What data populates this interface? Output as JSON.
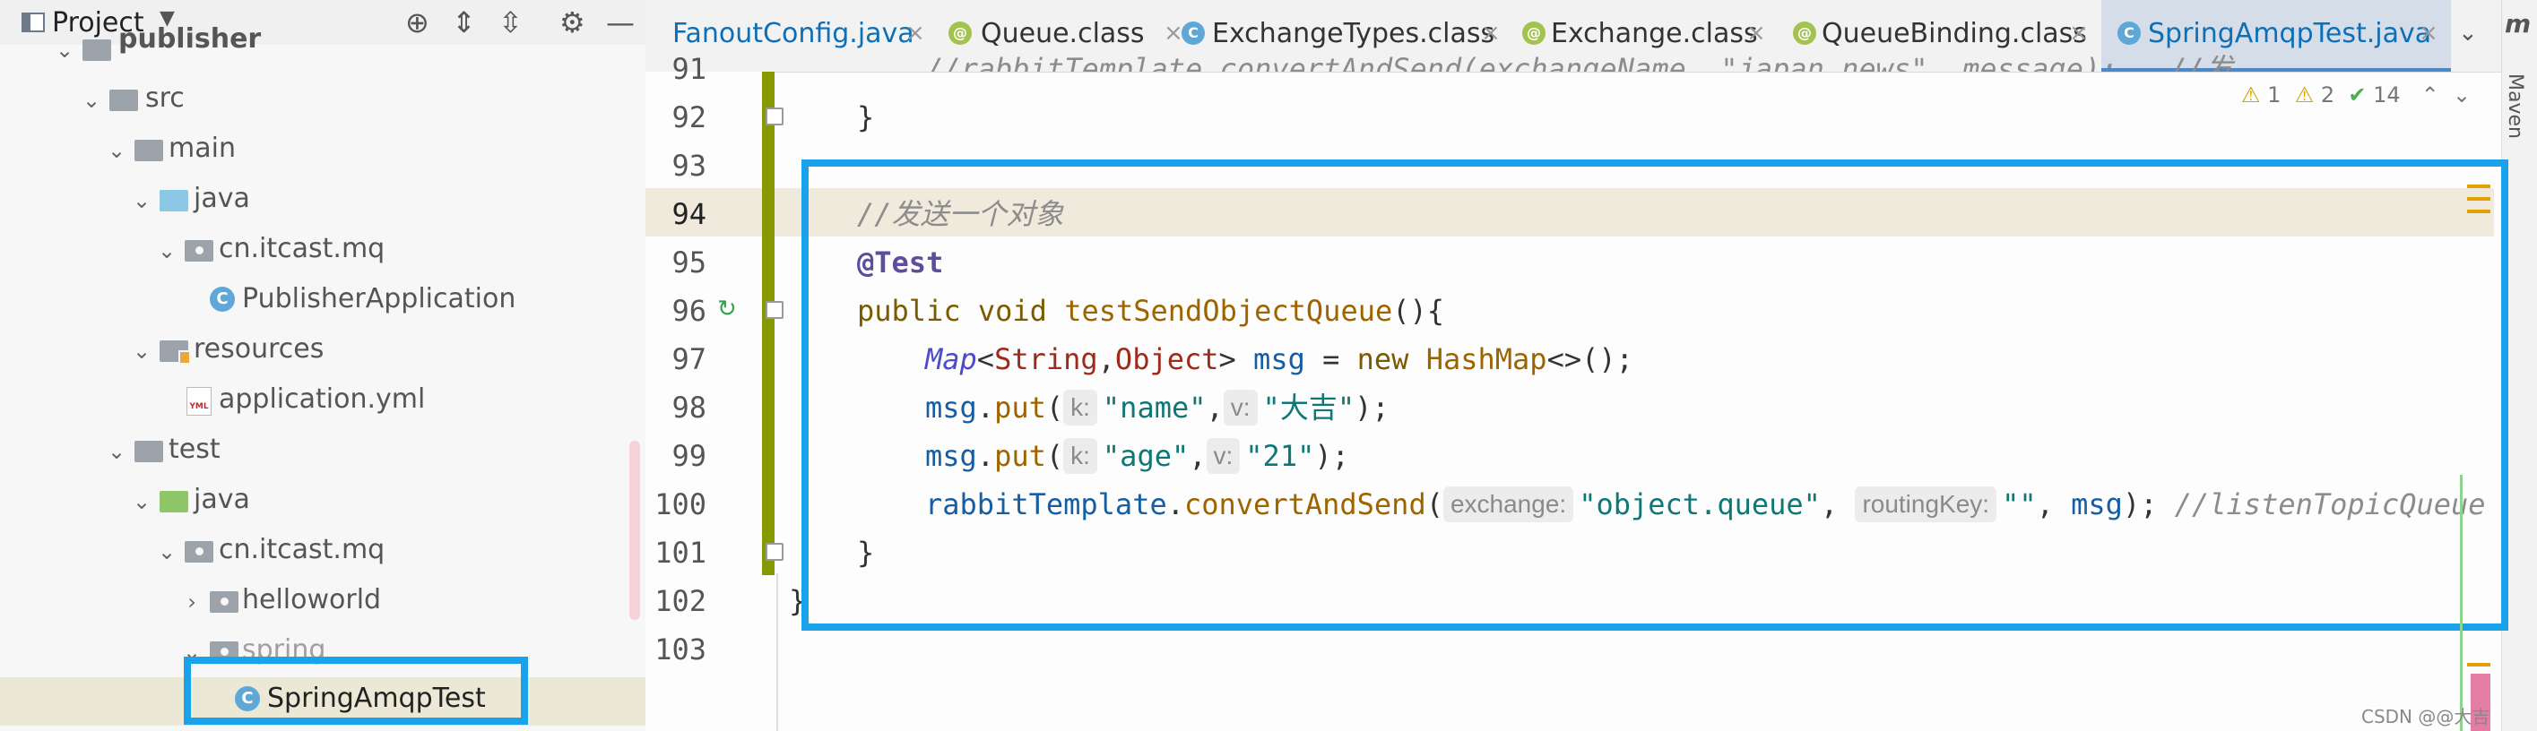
{
  "project_panel": {
    "title": "Project",
    "tools": [
      "crosshair-icon",
      "expand-all-icon",
      "collapse-all-icon",
      "gear-icon",
      "minimize-icon"
    ],
    "tree": [
      {
        "label": "publisher",
        "indent": 1,
        "icon": "module-folder",
        "arrow": "down",
        "muted": false
      },
      {
        "label": "src",
        "indent": 2,
        "icon": "folder",
        "arrow": "down"
      },
      {
        "label": "main",
        "indent": 3,
        "icon": "folder",
        "arrow": "down"
      },
      {
        "label": "java",
        "indent": 4,
        "icon": "source-folder",
        "arrow": "down"
      },
      {
        "label": "cn.itcast.mq",
        "indent": 5,
        "icon": "package",
        "arrow": "down"
      },
      {
        "label": "PublisherApplication",
        "indent": 6,
        "icon": "class",
        "arrow": "none"
      },
      {
        "label": "resources",
        "indent": 4,
        "icon": "resources-folder",
        "arrow": "down"
      },
      {
        "label": "application.yml",
        "indent": 5,
        "icon": "yml",
        "arrow": "none"
      },
      {
        "label": "test",
        "indent": 3,
        "icon": "folder",
        "arrow": "down"
      },
      {
        "label": "java",
        "indent": 4,
        "icon": "test-folder",
        "arrow": "down"
      },
      {
        "label": "cn.itcast.mq",
        "indent": 5,
        "icon": "package",
        "arrow": "down"
      },
      {
        "label": "helloworld",
        "indent": 6,
        "icon": "package",
        "arrow": "right"
      },
      {
        "label": "spring",
        "indent": 6,
        "icon": "package",
        "arrow": "down"
      },
      {
        "label": "SpringAmqpTest",
        "indent": 7,
        "icon": "class",
        "arrow": "none",
        "selected": true
      }
    ]
  },
  "tabs": [
    {
      "label": "FanoutConfig.java",
      "icon": "class",
      "java": true
    },
    {
      "label": "Queue.class",
      "icon": "interface"
    },
    {
      "label": "ExchangeTypes.class",
      "icon": "class"
    },
    {
      "label": "Exchange.class",
      "icon": "interface"
    },
    {
      "label": "QueueBinding.class",
      "icon": "interface"
    },
    {
      "label": "SpringAmqpTest.java",
      "icon": "class",
      "java": true,
      "active": true
    }
  ],
  "tool_window": {
    "label": "Maven"
  },
  "inspections": {
    "warnings_1": "1",
    "warnings_2": "2",
    "ok": "14"
  },
  "editor": {
    "line_numbers": [
      "91",
      "92",
      "93",
      "94",
      "95",
      "96",
      "97",
      "98",
      "99",
      "100",
      "101",
      "102",
      "103"
    ],
    "line_91": "    //rabbitTemplate.convertAndSend(exchangeName, \"japan.news\", message);   //发……",
    "line_92": "}",
    "line_94_comment": "//发送一个对象",
    "line_95_annotation": "@Test",
    "line_96": {
      "kw1": "public",
      "kw2": "void",
      "method": "testSendObjectQueue",
      "rest": "(){"
    },
    "line_97": {
      "type1": "Map",
      "lt": "<",
      "type2": "String",
      "comma": ",",
      "type3": "Object",
      "gt": "> ",
      "var": "msg",
      "eq": " = ",
      "kw": "new",
      "cls": "HashMap",
      "rest": "<>();"
    },
    "line_98": {
      "var": "msg",
      "dot": ".",
      "method": "put",
      "open": "(",
      "hint_k": "k:",
      "key": "\"name\"",
      "comma": ",",
      "hint_v": "v:",
      "value": "\"大吉\"",
      "close": ");"
    },
    "line_99": {
      "var": "msg",
      "dot": ".",
      "method": "put",
      "open": "(",
      "hint_k": "k:",
      "key": "\"age\"",
      "comma": ",",
      "hint_v": "v:",
      "value": "\"21\"",
      "close": ");"
    },
    "line_100": {
      "var": "rabbitTemplate",
      "dot": ".",
      "method": "convertAndSend",
      "open": "(",
      "hint1": "exchange:",
      "arg1": "\"object.queue\"",
      "comma1": ", ",
      "hint2": "routingKey:",
      "arg2": "\"\"",
      "comma2": ", ",
      "arg3": "msg",
      "close": "); ",
      "comment": "//listenTopicQueue"
    },
    "line_101": "}",
    "line_102": "}"
  },
  "watermark": "CSDN @@大吉",
  "colors": {
    "highlight": "#1aa3ea",
    "change_bar": "#869900",
    "active_tab": "#d4dde8"
  }
}
